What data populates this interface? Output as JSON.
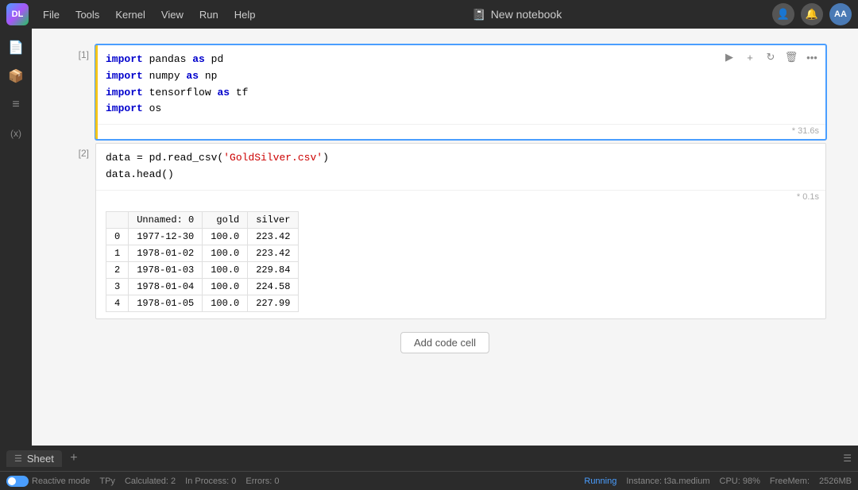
{
  "app": {
    "logo_text": "DL",
    "title": "New notebook",
    "title_icon": "📓"
  },
  "menubar": {
    "items": [
      "File",
      "Tools",
      "Kernel",
      "View",
      "Run",
      "Help"
    ]
  },
  "sidebar": {
    "icons": [
      {
        "name": "files-icon",
        "symbol": "📄"
      },
      {
        "name": "packages-icon",
        "symbol": "📦"
      },
      {
        "name": "outline-icon",
        "symbol": "≡"
      },
      {
        "name": "variables-icon",
        "symbol": "(x)"
      }
    ]
  },
  "cells": [
    {
      "number": "[1]",
      "type": "code",
      "active": true,
      "lines": [
        "import pandas as pd",
        "import numpy as np",
        "import tensorflow as tf",
        "import os"
      ],
      "exec_time": "* 31.6s"
    },
    {
      "number": "[2]",
      "type": "code",
      "active": false,
      "lines": [
        "data = pd.read_csv('GoldSilver.csv')",
        "data.head()"
      ],
      "exec_time": "* 0.1s",
      "output": {
        "type": "dataframe",
        "columns": [
          "",
          "Unnamed: 0",
          "gold",
          "silver"
        ],
        "rows": [
          [
            "0",
            "1977-12-30",
            "100.0",
            "223.42"
          ],
          [
            "1",
            "1978-01-02",
            "100.0",
            "223.42"
          ],
          [
            "2",
            "1978-01-03",
            "100.0",
            "229.84"
          ],
          [
            "3",
            "1978-01-04",
            "100.0",
            "224.58"
          ],
          [
            "4",
            "1978-01-05",
            "100.0",
            "227.99"
          ]
        ]
      }
    }
  ],
  "add_cell_button": "Add code cell",
  "bottom_tab": {
    "label": "Sheet",
    "add_label": "+"
  },
  "statusbar": {
    "mode": "Reactive mode",
    "lang": "TPy",
    "calculated": "Calculated: 2",
    "in_process": "In Process: 0",
    "errors": "Errors: 0",
    "running": "Running",
    "instance": "Instance: t3a.medium",
    "cpu": "CPU: 98%",
    "free_mem": "FreeMem:",
    "mem_value": "2526MB"
  },
  "cell_toolbar_buttons": [
    {
      "name": "run-icon",
      "symbol": "▶"
    },
    {
      "name": "add-below-icon",
      "symbol": "+"
    },
    {
      "name": "refresh-icon",
      "symbol": "↻"
    },
    {
      "name": "delete-icon",
      "symbol": "🗑"
    },
    {
      "name": "more-icon",
      "symbol": "···"
    }
  ]
}
